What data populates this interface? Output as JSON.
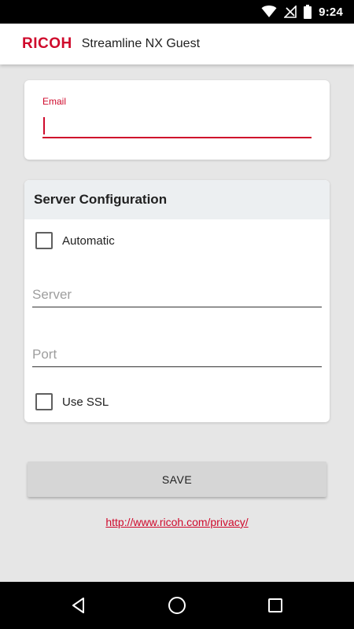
{
  "status_bar": {
    "time": "9:24",
    "icons": [
      "wifi-icon",
      "no-signal-icon",
      "battery-icon"
    ]
  },
  "app_bar": {
    "brand": "RICOH",
    "title": "Streamline NX Guest"
  },
  "email_section": {
    "label": "Email",
    "value": ""
  },
  "server_config": {
    "title": "Server Configuration",
    "automatic": {
      "label": "Automatic",
      "checked": false
    },
    "server": {
      "placeholder": "Server",
      "value": ""
    },
    "port": {
      "placeholder": "Port",
      "value": ""
    },
    "use_ssl": {
      "label": "Use SSL",
      "checked": false
    }
  },
  "save_button": {
    "label": "SAVE"
  },
  "privacy_link": {
    "text": "http://www.ricoh.com/privacy/"
  },
  "nav_bar": {
    "buttons": [
      "back-icon",
      "home-icon",
      "recents-icon"
    ]
  },
  "colors": {
    "accent": "#cf0a2c",
    "background": "#e6e6e6",
    "card": "#ffffff",
    "header": "#eceff1",
    "button": "#d6d6d6"
  }
}
